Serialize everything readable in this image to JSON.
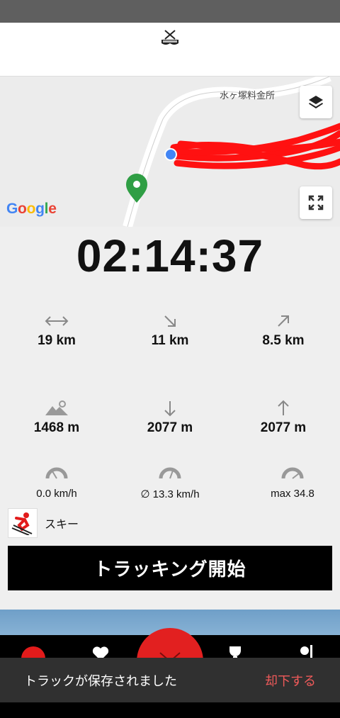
{
  "map": {
    "place_label": "水ヶ塚料金所",
    "google_logo": [
      "G",
      "o",
      "o",
      "g",
      "l",
      "e"
    ],
    "google_colors": [
      "#4285F4",
      "#EA4335",
      "#FBBC05",
      "#4285F4",
      "#34A853",
      "#EA4335"
    ],
    "track_color": "#ff1111",
    "marker_color": "#2f9e44",
    "location_color": "#4285f4",
    "icons": {
      "layers": "layers-icon",
      "fullscreen": "fullscreen-icon"
    }
  },
  "timer": {
    "elapsed": "02:14:37"
  },
  "stats_row1": [
    {
      "icon": "distance-icon",
      "value": "19 km"
    },
    {
      "icon": "downhill-distance-icon",
      "value": "11 km"
    },
    {
      "icon": "uphill-distance-icon",
      "value": "8.5 km"
    }
  ],
  "stats_row2": [
    {
      "icon": "altitude-icon",
      "value": "1468 m"
    },
    {
      "icon": "descent-icon",
      "value": "2077 m"
    },
    {
      "icon": "ascent-icon",
      "value": "2077 m"
    }
  ],
  "stats_speed": [
    {
      "icon": "speedometer-icon",
      "value": "0.0 km/h"
    },
    {
      "icon": "speedometer-icon",
      "value": "∅ 13.3 km/h"
    },
    {
      "icon": "speedometer-icon",
      "value": "max 34.8"
    }
  ],
  "activity": {
    "label": "スキー",
    "icon": "skier-icon"
  },
  "start_button": {
    "label": "トラッキング開始"
  },
  "snackbar": {
    "message": "トラックが保存されました",
    "action": "却下する"
  },
  "colors": {
    "accent": "#e22020",
    "button_bg": "#000000",
    "snackbar_bg": "#303030",
    "snackbar_action": "#f05a5a"
  }
}
